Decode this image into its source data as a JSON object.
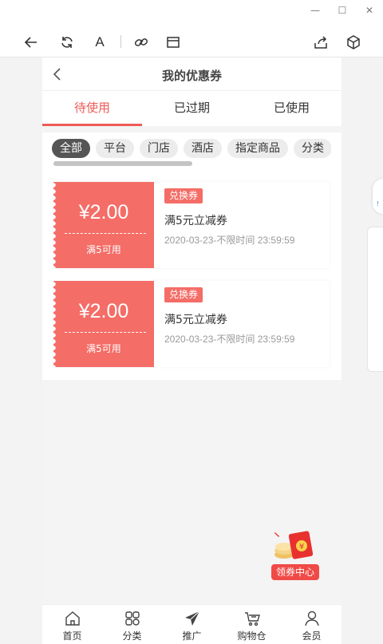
{
  "window": {
    "minimize": "—",
    "maximize": "☐",
    "close": "✕"
  },
  "toolbar": {
    "back": "back-arrow-icon",
    "refresh": "refresh-icon",
    "font": "A",
    "link": "link-icon",
    "window": "window-icon",
    "share": "share-icon",
    "cube": "cube-icon"
  },
  "header": {
    "title": "我的优惠券"
  },
  "tabs": [
    {
      "label": "待使用",
      "active": true
    },
    {
      "label": "已过期",
      "active": false
    },
    {
      "label": "已使用",
      "active": false
    }
  ],
  "filters": [
    {
      "label": "全部",
      "active": true
    },
    {
      "label": "平台",
      "active": false
    },
    {
      "label": "门店",
      "active": false
    },
    {
      "label": "酒店",
      "active": false
    },
    {
      "label": "指定商品",
      "active": false
    },
    {
      "label": "分类",
      "active": false
    }
  ],
  "coupons": [
    {
      "amount": "¥2.00",
      "condition": "满5可用",
      "badge": "兑换券",
      "name": "满5元立减券",
      "validity": "2020-03-23-不限时间 23:59:59"
    },
    {
      "amount": "¥2.00",
      "condition": "满5可用",
      "badge": "兑换券",
      "name": "满5元立减券",
      "validity": "2020-03-23-不限时间 23:59:59"
    }
  ],
  "floating": {
    "label": "领券中心"
  },
  "side_bubble": {
    "text": "!"
  },
  "nav": [
    {
      "label": "首页",
      "icon": "home-icon"
    },
    {
      "label": "分类",
      "icon": "grid-icon"
    },
    {
      "label": "推广",
      "icon": "paper-plane-icon"
    },
    {
      "label": "购物仓",
      "icon": "cart-icon"
    },
    {
      "label": "会员",
      "icon": "user-icon"
    }
  ],
  "colors": {
    "accent": "#ee5b56",
    "coupon": "#f46d67",
    "chip_active": "#555555"
  }
}
